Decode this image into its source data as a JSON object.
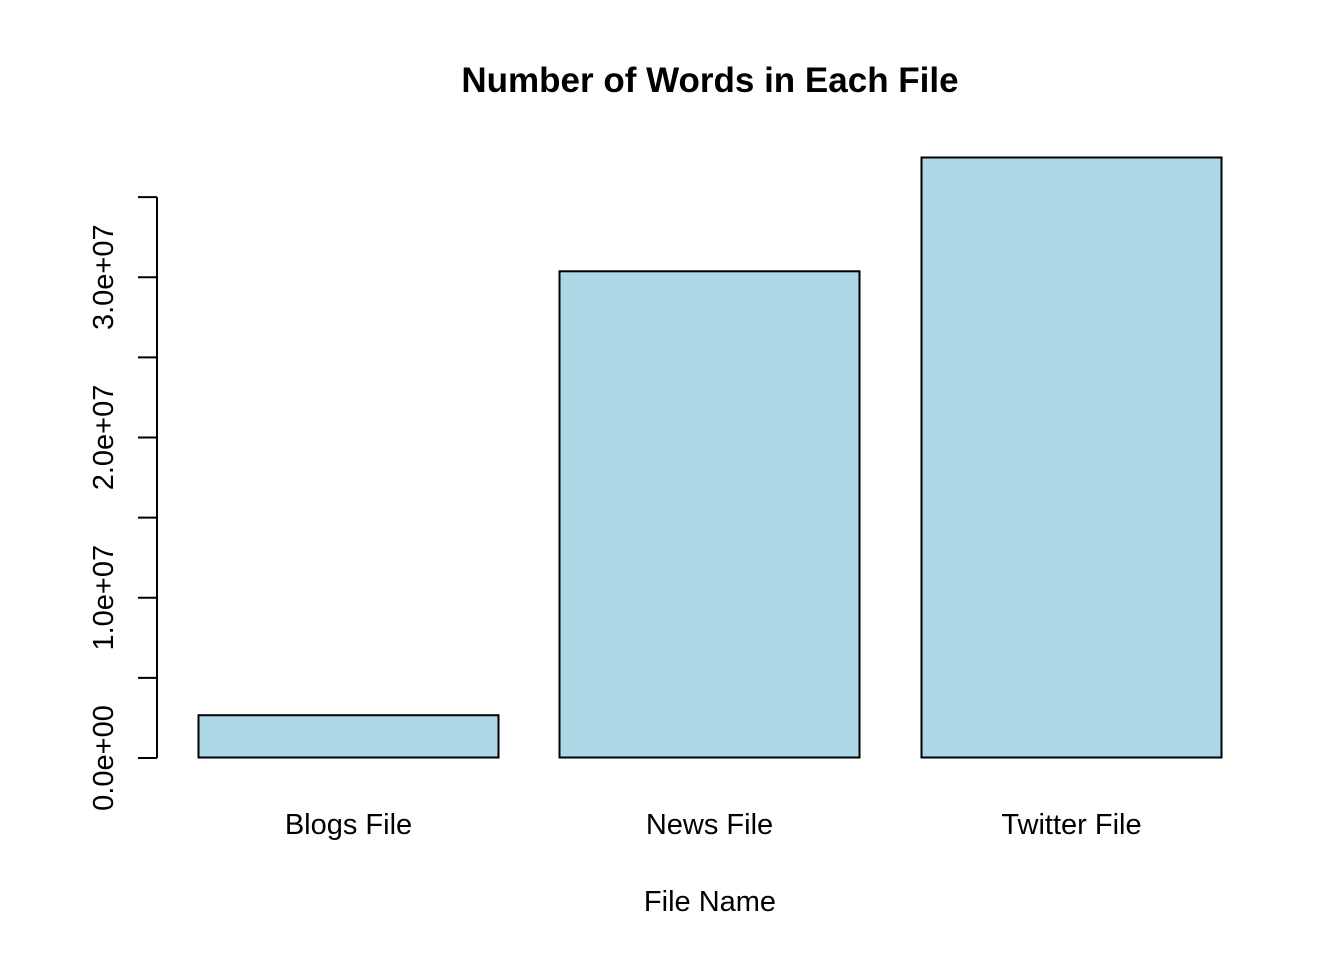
{
  "colors": {
    "bar_fill": "#add8e6",
    "bar_stroke": "#000000",
    "axis": "#000000",
    "background": "#ffffff"
  },
  "chart_data": {
    "type": "bar",
    "title": "Number of Words in Each File",
    "xlabel": "File Name",
    "ylabel": "",
    "categories": [
      "Blogs File",
      "News File",
      "Twitter File"
    ],
    "values": [
      2700000,
      30400000,
      37500000
    ],
    "ylim": [
      0,
      37500000
    ],
    "y_ticks": [
      0,
      5000000,
      10000000,
      15000000,
      20000000,
      25000000,
      30000000,
      35000000
    ],
    "y_tick_labels": [
      {
        "value": 0,
        "label": "0.0e+00"
      },
      {
        "value": 10000000,
        "label": "1.0e+07"
      },
      {
        "value": 20000000,
        "label": "2.0e+07"
      },
      {
        "value": 30000000,
        "label": "3.0e+07"
      }
    ],
    "grid": false,
    "legend": "none"
  }
}
